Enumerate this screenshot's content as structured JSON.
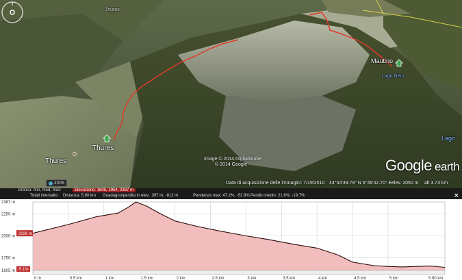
{
  "map": {
    "place_thures_top": "Thures",
    "place_thures_main": "Thures",
    "place_thures_lower": "Thures",
    "place_mautino": "Mautino",
    "place_lago_nero": "Lago Nero",
    "place_lago_edge": "Lago",
    "copyright_line1": "Image © 2014 DigitalGlobe",
    "copyright_line2": "© 2014 Google",
    "road_badge": "2005",
    "status_date": "Data di acquisizione delle immagini: 7/19/2010",
    "status_coords": "44°54'39.79\" N    6°48'42.70\" E",
    "status_elev": "elev. 2050 m",
    "status_alt": "alt   3.73 km",
    "logo_google": "Google",
    "logo_earth": "earth",
    "colors": {
      "track": "#e03a2a",
      "placemark": "#3aa64a"
    }
  },
  "profile": {
    "toolbar_row1": {
      "label": "Grafico: min, med, max:",
      "elevation": "Elevazione: 1605, 1954, 2387 m"
    },
    "toolbar_row2": {
      "total": "Totali intervallo:",
      "distance": "Distanza: 5.80 km",
      "gain": "Guadagno/perdita in elev.: 397 m, -812 m",
      "max_slope": "Pendenza max: 47.2%, -52.9%",
      "avg_slope": "Pendio medio: 21.6%, -19.7%"
    },
    "close_icon": "close-icon"
  },
  "chart_data": {
    "type": "area",
    "x": [
      0,
      0.5,
      0.9,
      1.2,
      1.35,
      1.45,
      1.6,
      1.8,
      2.0,
      2.3,
      2.6,
      3.0,
      3.3,
      3.7,
      4.0,
      4.3,
      4.5,
      4.8,
      5.0,
      5.2,
      5.4,
      5.6,
      5.8
    ],
    "series": [
      {
        "values": [
          2030,
          2130,
          2220,
          2260,
          2330,
          2387,
          2340,
          2250,
          2170,
          2110,
          2060,
          2000,
          1960,
          1900,
          1860,
          1780,
          1700,
          1660,
          1650,
          1645,
          1650,
          1655,
          1640
        ]
      }
    ],
    "x_ticks": [
      "0 m",
      "0.5 km",
      "1 km",
      "1.5 km",
      "2 km",
      "2.5 km",
      "3 km",
      "3.5 km",
      "4 km",
      "4.5 km",
      "5 km",
      "5.80 km"
    ],
    "x_tick_values": [
      0,
      0.5,
      1,
      1.5,
      2,
      2.5,
      3,
      3.5,
      4,
      4.5,
      5,
      5.8
    ],
    "y_ticks": [
      "1605 m",
      "1750 m",
      "2000 m",
      "2250 m",
      "2387 m"
    ],
    "y_tick_values": [
      1605,
      1750,
      2000,
      2250,
      2387
    ],
    "start_label": "2026 m",
    "end_label": "-5.1%",
    "xlim": [
      0,
      5.8
    ],
    "ylim": [
      1605,
      2387
    ],
    "grid": true,
    "colors": {
      "fill": "#f0b6b6",
      "line": "#2a0a0a",
      "axis_band": "#c03030"
    }
  }
}
